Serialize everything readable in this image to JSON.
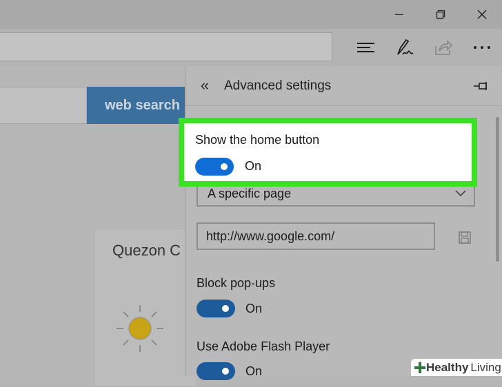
{
  "window": {
    "minimize_icon": "minimize-icon",
    "restore_icon": "restore-icon",
    "close_icon": "close-icon"
  },
  "toolbar": {
    "icons": [
      "hub-icon",
      "web-note-icon",
      "share-icon",
      "more-icon"
    ]
  },
  "page": {
    "search_button": "web search",
    "weather_city": "Quezon C"
  },
  "panel": {
    "title": "Advanced settings",
    "show_home": {
      "label": "Show the home button",
      "state": "On"
    },
    "home_page_option": "A specific page",
    "home_url": "http://www.google.com/",
    "block_popups": {
      "label": "Block pop-ups",
      "state": "On"
    },
    "flash": {
      "label": "Use Adobe Flash Player",
      "state": "On"
    }
  },
  "watermark": {
    "word1": "Healthy",
    "word2": "Living"
  },
  "colors": {
    "highlight": "#3ee027",
    "toggle_on": "#0f6dd6",
    "search_button": "#3a6f9e"
  }
}
